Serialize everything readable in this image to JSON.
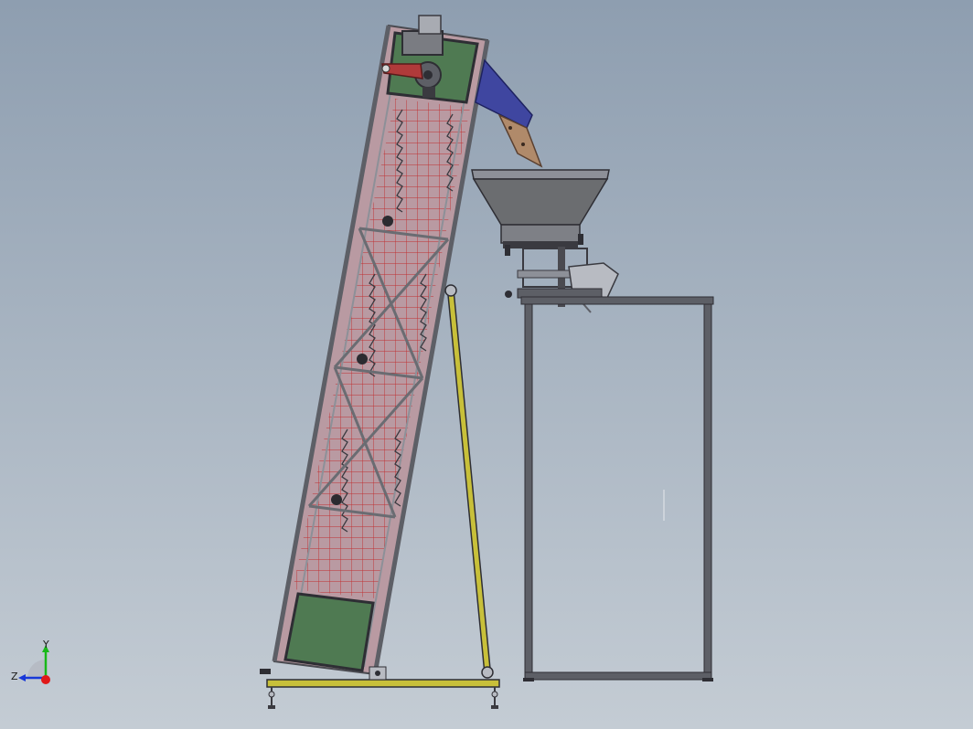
{
  "viewport": {
    "background_top": "#8e9eb0",
    "background_bottom": "#c4ccd4"
  },
  "colors": {
    "frame_steel": "#5d5f66",
    "frame_steel_light": "#8d9098",
    "mesh": "#c0282a",
    "motor_plate": "#4f7a52",
    "conveyor_body": "#b99aa2",
    "chute": "#3f46a0",
    "chute_lining": "#b08a6a",
    "hopper": "#6b6d70",
    "support_leg": "#c8c03a",
    "base_rail": "#c8c03a",
    "arm": "#b03a3a",
    "axis_x": "#e01818",
    "axis_y": "#18b818",
    "axis_z": "#1838d8"
  },
  "triad": {
    "y_label": "Y",
    "z_label": "Z"
  }
}
